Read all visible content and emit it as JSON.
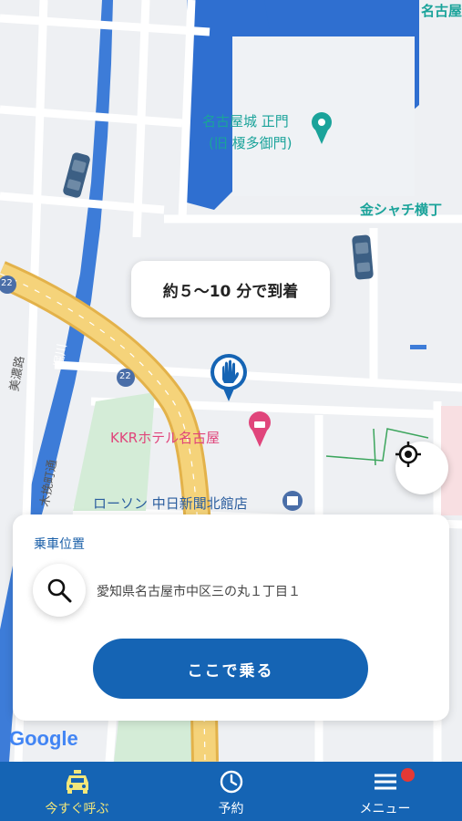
{
  "map": {
    "labels": {
      "nagoya_corner": "名古屋",
      "castle_gate_line1": "名古屋城 正門",
      "castle_gate_line2": "(旧 榎多御門)",
      "kinshachi": "金シャチ横丁",
      "kkr_hotel": "KKRホテル名古屋",
      "lawson": "ローソン 中日新聞北館店",
      "route_22_a": "22",
      "route_22_b": "22",
      "horikawa": "堀川",
      "mino_road": "美濃路",
      "kobiki": "木挽町通"
    },
    "colors": {
      "water": "#2f6fd0",
      "highway": "#f2c75c",
      "road": "#ffffff",
      "block": "#e9ecef",
      "park": "#d4ecd7",
      "hotel_pink": "#e0457b",
      "poi_teal": "#1aa39a"
    },
    "eta_text": "約５〜10 分で到着",
    "google_logo": "Google"
  },
  "panel": {
    "title": "乗車位置",
    "address": "愛知県名古屋市中区三の丸１丁目１",
    "ride_button": "ここで乗る"
  },
  "tabs": [
    {
      "label": "今すぐ呼ぶ",
      "icon": "taxi-icon",
      "active": true
    },
    {
      "label": "予約",
      "icon": "clock-icon",
      "active": false
    },
    {
      "label": "メニュー",
      "icon": "menu-icon",
      "active": false,
      "badge": true
    }
  ],
  "colors": {
    "primary": "#1564b4",
    "active_tab": "#f3e77a",
    "badge": "#e53935"
  }
}
